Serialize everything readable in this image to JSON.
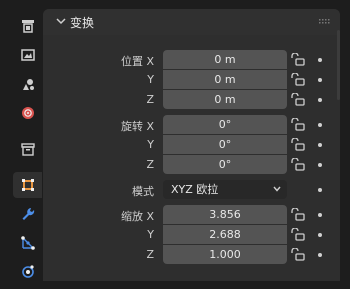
{
  "panel": {
    "title": "变换"
  },
  "location": {
    "label_x": "位置 X",
    "label_y": "Y",
    "label_z": "Z",
    "x": "0 m",
    "y": "0 m",
    "z": "0 m"
  },
  "rotation": {
    "label_x": "旋转 X",
    "label_y": "Y",
    "label_z": "Z",
    "x": "0°",
    "y": "0°",
    "z": "0°"
  },
  "mode": {
    "label": "模式",
    "value": "XYZ 欧拉"
  },
  "scale": {
    "label_x": "缩放 X",
    "label_y": "Y",
    "label_z": "Z",
    "x": "3.856",
    "y": "2.688",
    "z": "1.000"
  },
  "tabs": [
    "tool-icon",
    "render-icon",
    "output-icon",
    "world-icon",
    "collection-icon",
    "object-icon",
    "modifier-icon",
    "particles-icon",
    "physics-icon"
  ],
  "colors": {
    "accent_orange": "#e89540",
    "wrench_blue": "#4c8ee8",
    "world_red": "#d9534f"
  }
}
